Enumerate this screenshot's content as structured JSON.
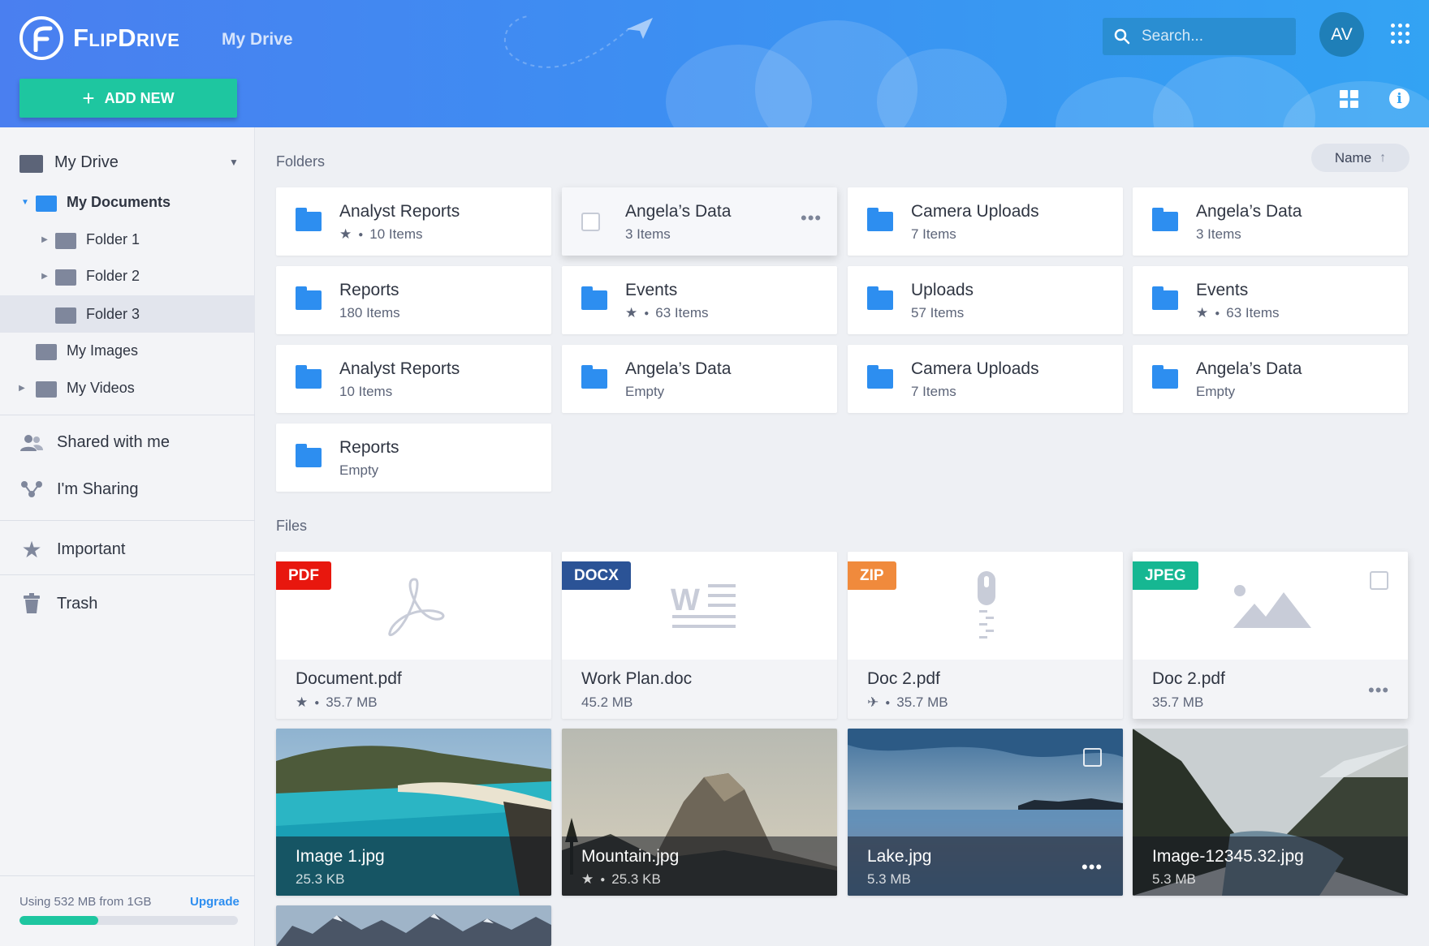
{
  "app": {
    "logo_text": "FlipDrive",
    "header_title": "My Drive",
    "add_new_label": "ADD NEW",
    "search_placeholder": "Search...",
    "avatar_initials": "AV"
  },
  "sidebar": {
    "root": "My Drive",
    "tree": [
      {
        "label": "My Documents",
        "expanded": true
      },
      {
        "label": "Folder 1"
      },
      {
        "label": "Folder 2"
      },
      {
        "label": "Folder 3",
        "selected": true
      },
      {
        "label": "My Images"
      },
      {
        "label": "My Videos"
      }
    ],
    "nav": [
      {
        "label": "Shared with me",
        "icon": "people-icon"
      },
      {
        "label": "I'm Sharing",
        "icon": "share-icon"
      },
      {
        "label": "Important",
        "icon": "star-icon"
      },
      {
        "label": "Trash",
        "icon": "trash-icon"
      }
    ],
    "usage_text": "Using 532 MB from 1GB",
    "upgrade_label": "Upgrade",
    "usage_fraction": 0.36
  },
  "main": {
    "folders_label": "Folders",
    "files_label": "Files",
    "sort_label": "Name",
    "folders": [
      {
        "name": "Analyst Reports",
        "meta": "10 Items",
        "starred": true
      },
      {
        "name": "Angela’s Data",
        "meta": "3 Items",
        "hover": true
      },
      {
        "name": "Camera Uploads",
        "meta": "7 Items"
      },
      {
        "name": "Angela’s Data",
        "meta": "3 Items"
      },
      {
        "name": "Reports",
        "meta": "180 Items"
      },
      {
        "name": "Events",
        "meta": "63 Items",
        "starred": true
      },
      {
        "name": "Uploads",
        "meta": "57 Items"
      },
      {
        "name": "Events",
        "meta": "63 Items",
        "starred": true
      },
      {
        "name": "Analyst Reports",
        "meta": "10 Items"
      },
      {
        "name": "Angela’s Data",
        "meta": "Empty"
      },
      {
        "name": "Camera Uploads",
        "meta": "7 Items"
      },
      {
        "name": "Angela’s Data",
        "meta": "Empty"
      },
      {
        "name": "Reports",
        "meta": "Empty"
      }
    ],
    "docs": [
      {
        "badge": "PDF",
        "color": "#e8170e",
        "name": "Document.pdf",
        "meta": "35.7 MB",
        "starred": true
      },
      {
        "badge": "DOCX",
        "color": "#2b5396",
        "name": "Work Plan.doc",
        "meta": "45.2 MB"
      },
      {
        "badge": "ZIP",
        "color": "#f08a3c",
        "name": "Doc 2.pdf",
        "meta": "35.7 MB",
        "plane": true
      },
      {
        "badge": "JPEG",
        "color": "#16b792",
        "name": "Doc 2.pdf",
        "meta": "35.7 MB",
        "hover": true
      }
    ],
    "images": [
      {
        "name": "Image 1.jpg",
        "meta": "25.3 KB"
      },
      {
        "name": "Mountain.jpg",
        "meta": "25.3 KB",
        "starred": true
      },
      {
        "name": "Lake.jpg",
        "meta": "5.3 MB",
        "hover": true
      },
      {
        "name": "Image-12345.32.jpg",
        "meta": "5.3 MB"
      }
    ]
  }
}
